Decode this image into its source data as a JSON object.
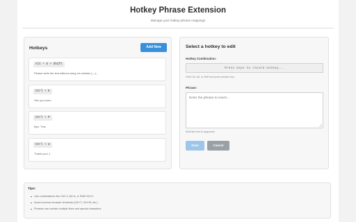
{
  "header": {
    "title": "Hotkey Phrase Extension",
    "subtitle": "Manage your hotkey-phrase mappings"
  },
  "hotkeys_panel": {
    "title": "Hotkeys",
    "add_button": "Add New",
    "items": [
      {
        "combo": "Alt + E + Shift",
        "phrase": "Please write the text without using em dashes (—)..."
      },
      {
        "combo": "Ctrl + K",
        "phrase": "See you soon."
      },
      {
        "combo": "Ctrl + P",
        "phrase": "Bye. This"
      },
      {
        "combo": "Ctrl + U",
        "phrase": "Thank you! :)"
      }
    ]
  },
  "editor_panel": {
    "title": "Select a hotkey to edit",
    "combo_label": "Hotkey Combination:",
    "combo_placeholder": "Press keys to record hotkey...",
    "combo_help": "Hold Ctrl, Alt, or Shift and press another key",
    "phrase_label": "Phrase:",
    "phrase_placeholder": "Enter the phrase to insert...",
    "phrase_help": "Multi-line text is supported",
    "save_button": "Save",
    "cancel_button": "Cancel"
  },
  "tips": {
    "title": "Tips:",
    "items": [
      "Use combinations like Ctrl+1, Alt+A, or Shift+Ctrl+L",
      "Avoid common browser shortcuts (Ctrl+T, Ctrl+W, etc.)",
      "Phrases can contain multiple lines and special characters"
    ]
  },
  "colors": {
    "accent": "#3a8fd9",
    "save_disabled": "#9ec6ea",
    "cancel": "#9aa0a5"
  }
}
